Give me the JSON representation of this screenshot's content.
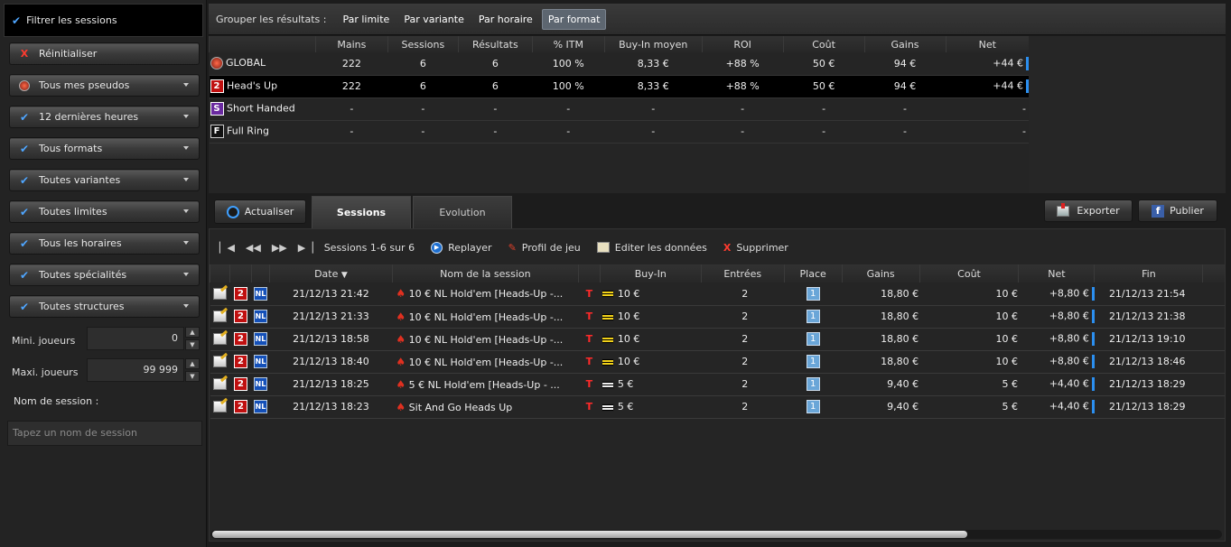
{
  "sidebar": {
    "header": "Filtrer les sessions",
    "buttons": [
      {
        "label": "Réinitialiser",
        "icon": "reset-x-icon"
      },
      {
        "label": "Tous mes pseudos",
        "icon": "pokerstars-logo-icon"
      },
      {
        "label": "12 dernières heures",
        "icon": "check-icon"
      },
      {
        "label": "Tous formats",
        "icon": "check-icon"
      },
      {
        "label": "Toutes variantes",
        "icon": "check-icon"
      },
      {
        "label": "Toutes limites",
        "icon": "check-icon"
      },
      {
        "label": "Tous les horaires",
        "icon": "check-icon"
      },
      {
        "label": "Toutes spécialités",
        "icon": "check-icon"
      },
      {
        "label": "Toutes structures",
        "icon": "check-icon"
      }
    ],
    "min_players_label": "Mini. joueurs",
    "min_players_value": "0",
    "max_players_label": "Maxi. joueurs",
    "max_players_value": "99 999",
    "session_name_label": "Nom de session :",
    "session_name_placeholder": "Tapez un nom de session"
  },
  "group_bar": {
    "label": "Grouper les résultats :",
    "buttons": [
      "Par limite",
      "Par variante",
      "Par horaire",
      "Par format"
    ],
    "active": "Par format"
  },
  "summary": {
    "columns": [
      "Mains",
      "Sessions",
      "Résultats",
      "% ITM",
      "Buy-In moyen",
      "ROI",
      "Coût",
      "Gains",
      "Net"
    ],
    "rows": [
      {
        "tag": "",
        "name": "GLOBAL",
        "values": [
          "222",
          "6",
          "6",
          "100 %",
          "8,33 €",
          "+88 %",
          "50 €",
          "94 €",
          "+44 €"
        ]
      },
      {
        "tag": "2",
        "name": "Head's Up",
        "values": [
          "222",
          "6",
          "6",
          "100 %",
          "8,33 €",
          "+88 %",
          "50 €",
          "94 €",
          "+44 €"
        ]
      },
      {
        "tag": "S",
        "name": "Short Handed",
        "values": [
          "-",
          "-",
          "-",
          "-",
          "-",
          "-",
          "-",
          "-",
          "-"
        ]
      },
      {
        "tag": "F",
        "name": "Full Ring",
        "values": [
          "-",
          "-",
          "-",
          "-",
          "-",
          "-",
          "-",
          "-",
          "-"
        ]
      }
    ]
  },
  "tabs": {
    "refresh": "Actualiser",
    "sessions": "Sessions",
    "evolution": "Evolution",
    "export": "Exporter",
    "publish": "Publier"
  },
  "toolbar": {
    "range": "Sessions 1-6 sur 6",
    "replay": "Replayer",
    "profile": "Profil de jeu",
    "edit": "Editer les données",
    "delete": "Supprimer"
  },
  "sessions": {
    "columns": [
      "Date",
      "Nom de la session",
      "Buy-In",
      "Entrées",
      "Place",
      "Gains",
      "Coût",
      "Net",
      "Fin"
    ],
    "rows": [
      {
        "date": "21/12/13 21:42",
        "name": "10 € NL Hold'em [Heads-Up -...",
        "buyin": "10 €",
        "entries": "2",
        "place": "1",
        "gains": "18,80 €",
        "cost": "10 €",
        "net": "+8,80 €",
        "end": "21/12/13 21:54",
        "speed": "yellow"
      },
      {
        "date": "21/12/13 21:33",
        "name": "10 € NL Hold'em [Heads-Up -...",
        "buyin": "10 €",
        "entries": "2",
        "place": "1",
        "gains": "18,80 €",
        "cost": "10 €",
        "net": "+8,80 €",
        "end": "21/12/13 21:38",
        "speed": "yellow"
      },
      {
        "date": "21/12/13 18:58",
        "name": "10 € NL Hold'em [Heads-Up -...",
        "buyin": "10 €",
        "entries": "2",
        "place": "1",
        "gains": "18,80 €",
        "cost": "10 €",
        "net": "+8,80 €",
        "end": "21/12/13 19:10",
        "speed": "yellow"
      },
      {
        "date": "21/12/13 18:40",
        "name": "10 € NL Hold'em [Heads-Up -...",
        "buyin": "10 €",
        "entries": "2",
        "place": "1",
        "gains": "18,80 €",
        "cost": "10 €",
        "net": "+8,80 €",
        "end": "21/12/13 18:46",
        "speed": "yellow"
      },
      {
        "date": "21/12/13 18:25",
        "name": "5 € NL Hold'em [Heads-Up - ...",
        "buyin": "5 €",
        "entries": "2",
        "place": "1",
        "gains": "9,40 €",
        "cost": "5 €",
        "net": "+4,40 €",
        "end": "21/12/13 18:29",
        "speed": "white"
      },
      {
        "date": "21/12/13 18:23",
        "name": "Sit And Go Heads Up",
        "buyin": "5 €",
        "entries": "2",
        "place": "1",
        "gains": "9,40 €",
        "cost": "5 €",
        "net": "+4,40 €",
        "end": "21/12/13 18:29",
        "speed": "white"
      }
    ],
    "row_tag": "2",
    "row_limit": "NL",
    "row_structure": "T"
  },
  "colors": {
    "accent": "#4fa6ff",
    "net_bar": "#2b8ff0",
    "tag_red": "#c01010"
  }
}
